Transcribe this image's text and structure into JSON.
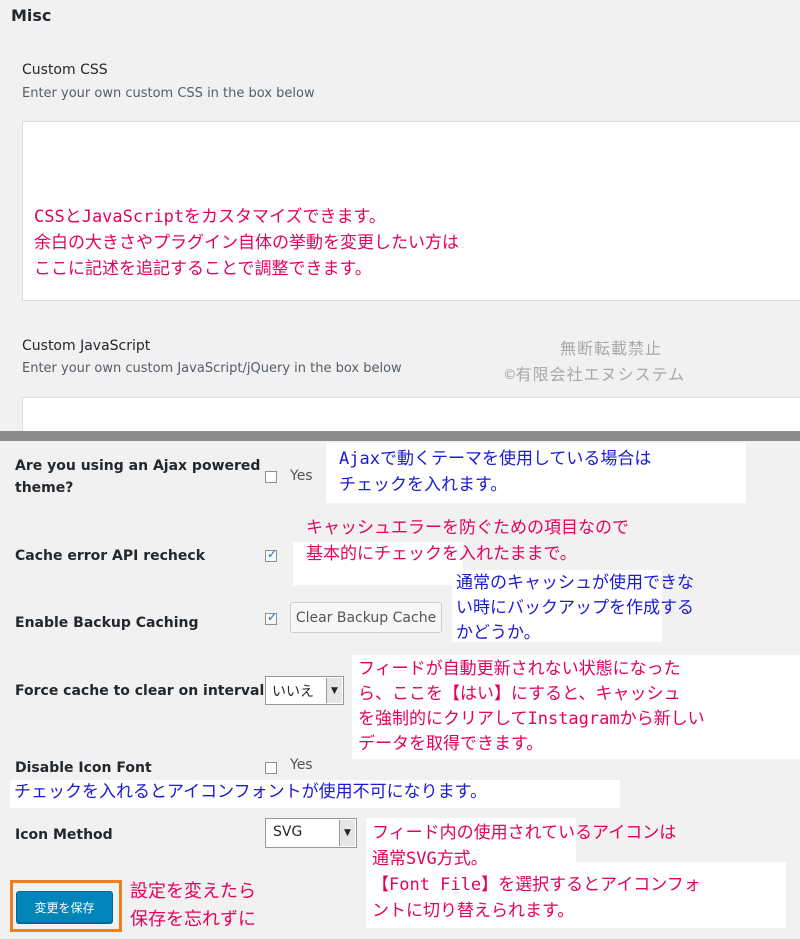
{
  "misc": {
    "title": "Misc",
    "custom_css": {
      "label": "Custom CSS",
      "description": "Enter your own custom CSS in the box below",
      "annotation": [
        "CSSとJavaScriptをカスタマイズできます。",
        "余白の大きさやプラグイン自体の挙動を変更したい方は",
        "ここに記述を追記することで調整できます。"
      ]
    },
    "custom_js": {
      "label": "Custom JavaScript",
      "description": "Enter your own custom JavaScript/jQuery in the box below"
    },
    "watermark": [
      "無断転載禁止",
      "©有限会社エヌシステム"
    ]
  },
  "settings": {
    "ajax": {
      "label": [
        "Are you using an Ajax powered",
        "theme?"
      ],
      "yes": "Yes",
      "checked": false,
      "note": [
        "Ajaxで動くテーマを使用している場合は",
        "チェックを入れます。"
      ]
    },
    "cache_recheck": {
      "label": "Cache error API recheck",
      "checked": true,
      "note": [
        "キャッシュエラーを防ぐための項目なので",
        "基本的にチェックを入れたままで。"
      ]
    },
    "backup_caching": {
      "label": "Enable Backup Caching",
      "checked": true,
      "button": "Clear Backup Cache",
      "note": [
        "通常のキャッシュが使用できな",
        "い時にバックアップを作成する",
        "かどうか。"
      ]
    },
    "force_clear": {
      "label": "Force cache to clear on interval",
      "selected": "いいえ",
      "note": [
        "フィードが自動更新されない状態になった",
        "ら、ここを【はい】にすると、キャッシュ",
        "を強制的にクリアしてInstagramから新しい",
        "データを取得できます。"
      ]
    },
    "icon_font": {
      "label": "Disable Icon Font",
      "yes": "Yes",
      "checked": false,
      "note": "チェックを入れるとアイコンフォントが使用不可になります。"
    },
    "icon_method": {
      "label": "Icon Method",
      "selected": "SVG",
      "note": [
        "フィード内の使用されているアイコンは",
        "通常SVG方式。",
        "【Font File】を選択するとアイコンフォ",
        "ントに切り替えられます。"
      ]
    },
    "save": {
      "button": "変更を保存",
      "note": [
        "設定を変えたら",
        "保存を忘れずに"
      ]
    }
  },
  "colors": {
    "annotation_magenta": "#e5005f",
    "annotation_blue": "#1a1ad6",
    "primary_button": "#0085ba",
    "highlight_frame": "#f07d1e"
  }
}
